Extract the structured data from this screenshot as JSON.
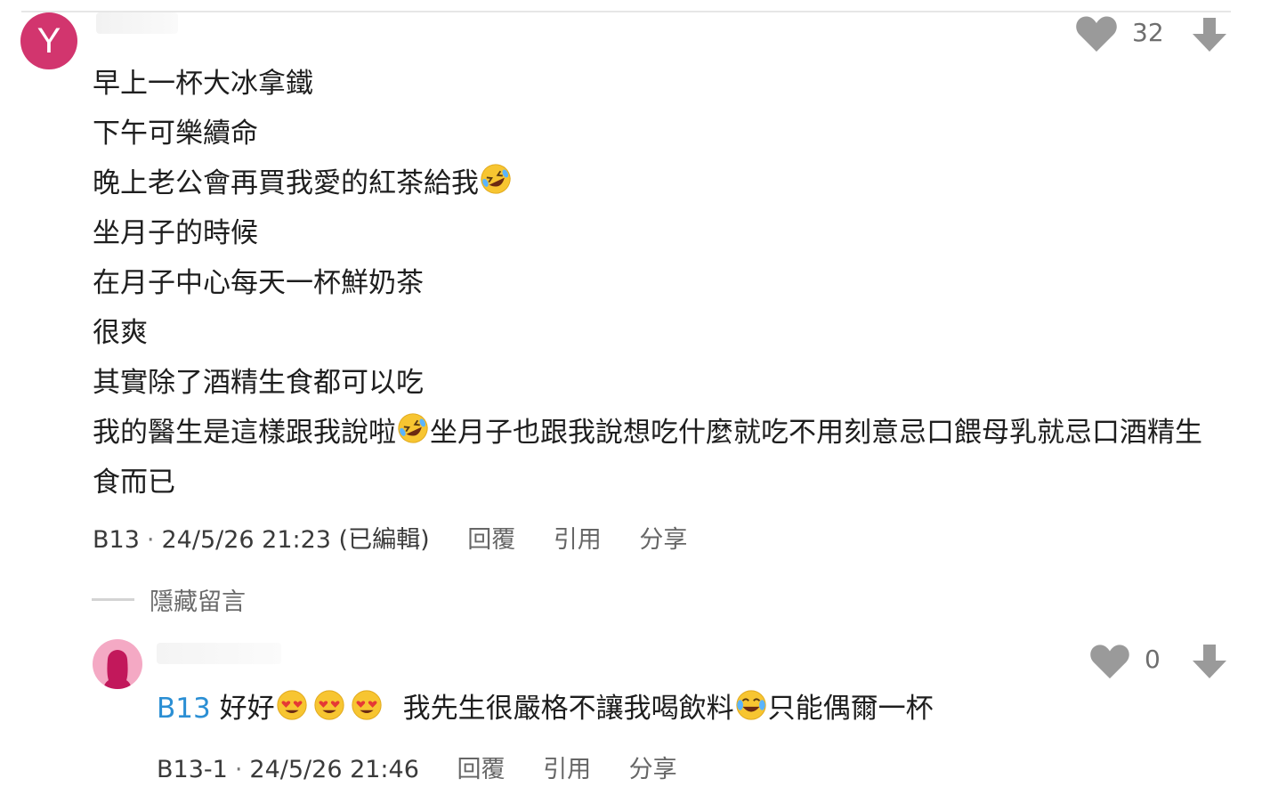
{
  "colors": {
    "avatar_main": "#d2356e",
    "reply_link": "#2b8fd4",
    "icon_gray": "#9a9a9a"
  },
  "comment": {
    "avatar_letter": "Y",
    "like_count": "32",
    "lines": [
      "早上一杯大冰拿鐵",
      "下午可樂續命",
      "晚上老公會再買我愛的紅茶給我",
      "坐月子的時候",
      "在月子中心每天一杯鮮奶茶",
      "很爽",
      "其實除了酒精生食都可以吃"
    ],
    "last_part_a": "我的醫生是這樣跟我說啦",
    "last_part_b": "坐月子也跟我說想吃什麼就吃不用刻意忌口餵母乳就忌口酒精生食而已",
    "floor": "B13",
    "separator": "·",
    "timestamp": "24/5/26 21:23 (已編輯)",
    "actions": {
      "reply": "回覆",
      "quote": "引用",
      "share": "分享"
    }
  },
  "hide_comments": "隱藏留言",
  "reply": {
    "like_count": "0",
    "ref": "B13",
    "text_a": "好好",
    "text_b": "我先生很嚴格不讓我喝飲料",
    "text_c": "只能偶爾一杯",
    "floor": "B13-1",
    "separator": "·",
    "timestamp": "24/5/26 21:46",
    "actions": {
      "reply": "回覆",
      "quote": "引用",
      "share": "分享"
    }
  }
}
